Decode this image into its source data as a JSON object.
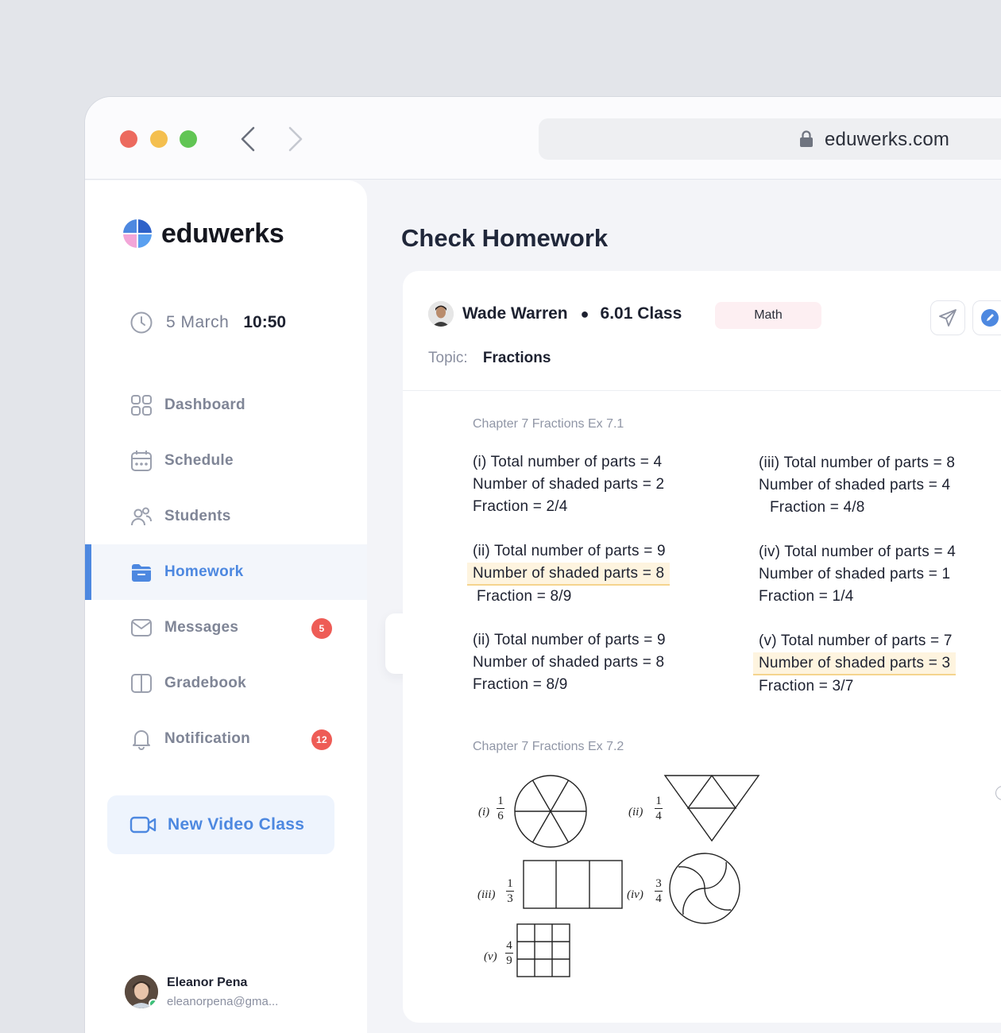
{
  "browser": {
    "url": "eduwerks.com"
  },
  "sidebar": {
    "brand": "eduwerks",
    "date": "5 March",
    "time": "10:50",
    "items": [
      {
        "label": "Dashboard",
        "icon": "grid-icon"
      },
      {
        "label": "Schedule",
        "icon": "calendar-icon"
      },
      {
        "label": "Students",
        "icon": "users-icon"
      },
      {
        "label": "Homework",
        "icon": "folder-icon",
        "active": true
      },
      {
        "label": "Messages",
        "icon": "mail-icon",
        "badge": "5"
      },
      {
        "label": "Gradebook",
        "icon": "book-icon"
      },
      {
        "label": "Notification",
        "icon": "bell-icon",
        "badge": "12"
      }
    ],
    "cta": "New Video Class",
    "user": {
      "name": "Eleanor Pena",
      "email": "eleanorpena@gma..."
    }
  },
  "main": {
    "title": "Check Homework",
    "student": "Wade Warren",
    "class": "6.01 Class",
    "subject": "Math",
    "topic_label": "Topic:",
    "topic": "Fractions",
    "chapter1": "Chapter 7 Fractions Ex 7.1",
    "chapter2": "Chapter 7 Fractions Ex 7.2",
    "exercises": [
      {
        "lines": [
          "(i) Total number of parts = 4",
          "Number of shaded parts = 2",
          "Fraction = 2/4"
        ],
        "highlight": null
      },
      {
        "lines": [
          "(iii) Total number of parts = 8",
          "Number of shaded parts = 4",
          "Fraction = 4/8"
        ],
        "highlight": null
      },
      {
        "lines": [
          "(ii) Total number of parts = 9",
          "Number of shaded parts = 8",
          "Fraction = 8/9"
        ],
        "highlight": 1
      },
      {
        "lines": [
          "(iv) Total number of parts = 4",
          "Number of shaded parts = 1",
          "Fraction = 1/4"
        ],
        "highlight": null
      },
      {
        "lines": [
          "(ii) Total number of parts = 9",
          "Number of shaded parts = 8",
          "Fraction = 8/9"
        ],
        "highlight": null
      },
      {
        "lines": [
          "(v) Total number of parts = 7",
          "Number of shaded parts = 3",
          "Fraction = 3/7"
        ],
        "highlight": 1
      }
    ],
    "figures": [
      {
        "tag": "(i)",
        "num": "1",
        "den": "6"
      },
      {
        "tag": "(ii)",
        "num": "1",
        "den": "4"
      },
      {
        "tag": "(iii)",
        "num": "1",
        "den": "3"
      },
      {
        "tag": "(iv)",
        "num": "3",
        "den": "4"
      },
      {
        "tag": "(v)",
        "num": "4",
        "den": "9"
      }
    ]
  },
  "colors": {
    "accent": "#4d88e0",
    "badge": "#ee5c56",
    "highlight": "#fef4df",
    "subject_pill": "#fdeff2"
  }
}
